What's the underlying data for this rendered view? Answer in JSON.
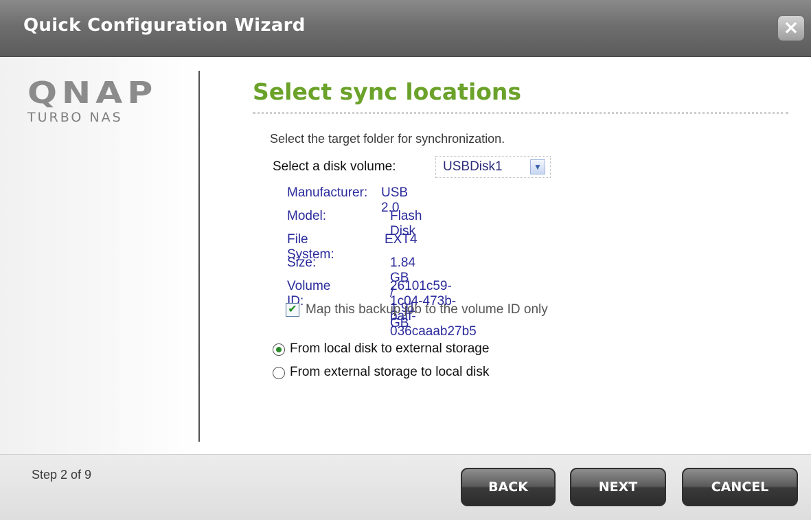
{
  "window": {
    "title": "Quick Configuration Wizard",
    "close_label": "×"
  },
  "brand": {
    "logo": "QNAP",
    "subtitle": "TURBO NAS"
  },
  "page": {
    "title": "Select sync locations",
    "instruction": "Select the target folder for synchronization.",
    "disk_volume_label": "Select a disk volume:",
    "disk_volume_value": "USBDisk1"
  },
  "disk_info": {
    "manufacturer_label": "Manufacturer:",
    "manufacturer_value": "USB 2.0",
    "model_label": "Model:",
    "model_value": "Flash Disk",
    "filesystem_label": "File System:",
    "filesystem_value": "EXT4",
    "size_label": "Size:",
    "size_value": "1.84 GB / 1.91 GB",
    "volume_id_label": "Volume ID:",
    "volume_id_value": "26101c59-1c04-473b-baff-036caaab27b5"
  },
  "map_volume": {
    "label": "Map this backup job to the volume ID only",
    "checked": true
  },
  "direction": {
    "option1": "From local disk to external storage",
    "option2": "From external storage to local disk",
    "selected": 1
  },
  "footer": {
    "step": "Step 2 of 9",
    "back": "BACK",
    "next": "NEXT",
    "cancel": "CANCEL"
  },
  "colors": {
    "title_green": "#6ba22a",
    "info_blue": "#2a2a9c",
    "titlebar": "#6e6e6e"
  }
}
